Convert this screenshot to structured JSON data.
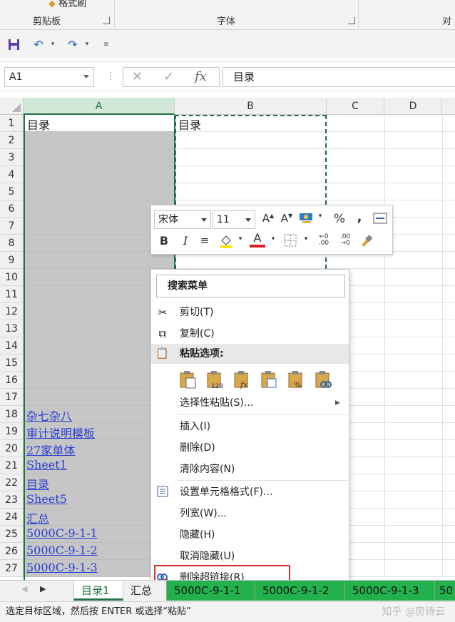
{
  "ribbon": {
    "top_label": "格式刷",
    "groups": [
      {
        "label": "剪贴板"
      },
      {
        "label": "字体"
      },
      {
        "label": "对齐"
      }
    ]
  },
  "qat": {
    "save_icon": "save-icon",
    "undo_icon": "undo-icon",
    "redo_icon": "redo-icon",
    "customize_icon": "customize-icon"
  },
  "formula_bar": {
    "name_box": "A1",
    "fx": "fx",
    "formula": "目录"
  },
  "grid": {
    "columns": [
      "A",
      "B",
      "C",
      "D"
    ],
    "rows": [
      "1",
      "2",
      "3",
      "4",
      "5",
      "6",
      "7",
      "8",
      "9",
      "10",
      "11",
      "12",
      "13",
      "14",
      "15",
      "16",
      "17",
      "18",
      "19",
      "20",
      "21",
      "22",
      "23",
      "24",
      "25",
      "26",
      "27"
    ],
    "a1": "目录",
    "b1": "目录",
    "links": [
      "杂七杂八",
      "审计说明模板",
      "27家单体",
      "Sheet1",
      "目录",
      "Sheet5",
      "汇总",
      "5000C-9-1-1",
      "5000C-9-1-2",
      "5000C-9-1-3"
    ]
  },
  "mini_toolbar": {
    "font_name": "宋体",
    "font_size": "11",
    "bold": "B",
    "italic": "I",
    "percent": "%",
    "comma": ","
  },
  "context_menu": {
    "search": "搜索菜单",
    "cut": "剪切(T)",
    "copy": "复制(C)",
    "paste_header": "粘贴选项:",
    "paste_special": "选择性粘贴(S)...",
    "insert": "插入(I)",
    "delete": "删除(D)",
    "clear": "清除内容(N)",
    "format_cells": "设置单元格格式(F)...",
    "col_width": "列宽(W)...",
    "hide": "隐藏(H)",
    "unhide": "取消隐藏(U)",
    "remove_hyperlink": "删除超链接(R)"
  },
  "sheet_tabs": {
    "tabs": [
      "目录1",
      "汇总",
      "5000C-9-1-1",
      "5000C-9-1-2",
      "5000C-9-1-3",
      "50"
    ],
    "active_index": 0
  },
  "status": {
    "message": "选定目标区域，然后按 ENTER 或选择“粘贴”",
    "watermark": "知乎 @房诗云"
  },
  "colors": {
    "excel_green": "#217346",
    "link_blue": "#2a3fd3",
    "tab_green": "#22b14c",
    "highlight_red": "#d03030"
  }
}
